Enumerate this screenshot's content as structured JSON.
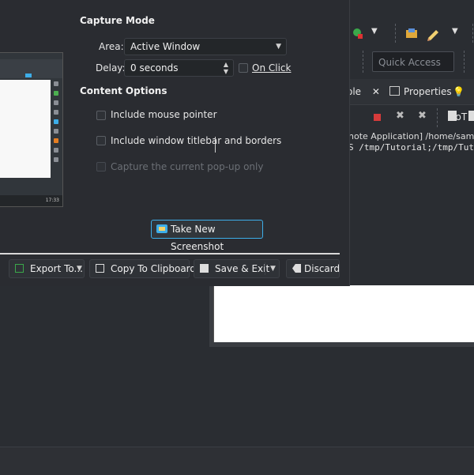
{
  "dialog": {
    "capture_mode_title": "Capture Mode",
    "area_label": "Area:",
    "area_value": "Active Window",
    "delay_label": "Delay:",
    "delay_value": "0 seconds",
    "on_click_label": "On Click",
    "content_options_title": "Content Options",
    "options": [
      {
        "label": "Include mouse pointer",
        "checked": false,
        "enabled": true
      },
      {
        "label": "Include window titlebar and borders",
        "checked": false,
        "enabled": true
      },
      {
        "label": "Capture the current pop-up only",
        "checked": false,
        "enabled": false
      }
    ],
    "take_screenshot_label": "Take New Screenshot",
    "thumbnail_clock": "17:33",
    "buttons": {
      "export": "Export To...",
      "copy": "Copy To Clipboard",
      "save_exit": "Save & Exit",
      "discard": "Discard"
    }
  },
  "ide": {
    "quick_access_placeholder": "Quick Access",
    "tabs": [
      {
        "label": "ole",
        "icon": "console-icon",
        "closable": true
      },
      {
        "label": "Properties",
        "icon": "properties-icon"
      },
      {
        "label": "IoT",
        "icon": "lightbulb-icon"
      }
    ],
    "console_header": "note Application] /home/samuel",
    "console_text": "S /tmp/Tutorial;/tmp/Tutorial"
  },
  "colors": {
    "accent": "#3daee9",
    "background": "#26282d",
    "dialog_bg": "#2a2c31"
  }
}
